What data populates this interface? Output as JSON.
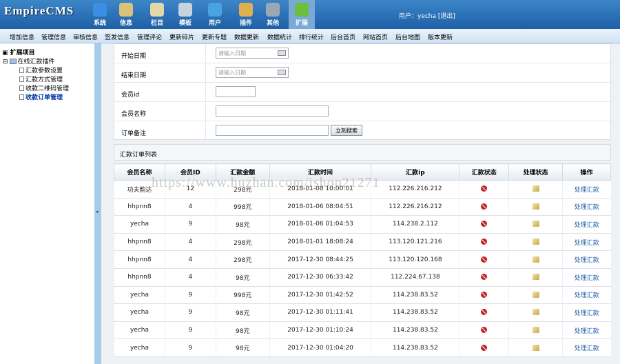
{
  "app": {
    "logo": "EmpireCMS"
  },
  "topnav": [
    {
      "label": "系统",
      "icon": "globe-icon",
      "color": "#3a8ee6"
    },
    {
      "label": "信息",
      "icon": "pencil-doc-icon",
      "color": "#d9c27a"
    },
    {
      "label": "栏目",
      "icon": "folder-icon",
      "color": "#e3d7a8"
    },
    {
      "label": "模板",
      "icon": "template-icon",
      "color": "#c9d3de"
    },
    {
      "label": "用户",
      "icon": "user-icon",
      "color": "#4aa3df"
    },
    {
      "label": "插件",
      "icon": "tools-icon",
      "color": "#e0b050"
    },
    {
      "label": "其他",
      "icon": "gear-icon",
      "color": "#9aa8b4"
    },
    {
      "label": "扩展",
      "icon": "plus-icon",
      "color": "#6cbf3a"
    }
  ],
  "user": {
    "text": "用户：yecha [退出]"
  },
  "menu": [
    "增加信息",
    "管理信息",
    "审核信息",
    "签发信息",
    "管理评论",
    "更新碎片",
    "更新专题",
    "数据更新",
    "数据统计",
    "排行统计",
    "后台首页",
    "网站首页",
    "后台地图",
    "版本更新"
  ],
  "sidebar": {
    "root": "扩展项目",
    "plugin": "在线汇款插件",
    "items": [
      "汇款参数设置",
      "汇款方式管理",
      "收款二维码管理",
      "收款订单管理"
    ],
    "collapse_arrow": "◂"
  },
  "form": {
    "start_label": "开始日期",
    "start_placeholder": "请输入日期",
    "end_label": "结束日期",
    "end_placeholder": "请输入日期",
    "member_id_label": "会员id",
    "member_name_label": "会员名称",
    "note_label": "订单备注",
    "search_button": "立刻搜索"
  },
  "list": {
    "title": "汇款订单列表",
    "columns": [
      "会员名称",
      "会员ID",
      "汇款金额",
      "汇款时间",
      "汇款ip",
      "汇款状态",
      "处理状态",
      "操作"
    ],
    "action_label": "处理汇款",
    "rows": [
      {
        "name": "功夫韵达",
        "id": "12",
        "amount": "298元",
        "time": "2018-01-08 10:00:01",
        "ip": "112.226.216.212"
      },
      {
        "name": "hhpnn8",
        "id": "4",
        "amount": "998元",
        "time": "2018-01-06 08:04:51",
        "ip": "112.226.216.212"
      },
      {
        "name": "yecha",
        "id": "9",
        "amount": "98元",
        "time": "2018-01-06 01:04:53",
        "ip": "114.238.2.112"
      },
      {
        "name": "hhpnn8",
        "id": "4",
        "amount": "298元",
        "time": "2018-01-01 18:08:24",
        "ip": "113.120.121.216"
      },
      {
        "name": "hhpnn8",
        "id": "4",
        "amount": "298元",
        "time": "2017-12-30 08:44:25",
        "ip": "113.120.120.168"
      },
      {
        "name": "hhpnn8",
        "id": "4",
        "amount": "98元",
        "time": "2017-12-30 06:33:42",
        "ip": "112.224.67.138"
      },
      {
        "name": "yecha",
        "id": "9",
        "amount": "998元",
        "time": "2017-12-30 01:42:52",
        "ip": "114.238.83.52"
      },
      {
        "name": "yecha",
        "id": "9",
        "amount": "98元",
        "time": "2017-12-30 01:11:41",
        "ip": "114.238.83.52"
      },
      {
        "name": "yecha",
        "id": "9",
        "amount": "98元",
        "time": "2017-12-30 01:10:24",
        "ip": "114.238.83.52"
      },
      {
        "name": "yecha",
        "id": "9",
        "amount": "98元",
        "time": "2017-12-30 01:04:20",
        "ip": "114.238.83.52"
      }
    ]
  },
  "watermark": "https://www.huzhan.com/ishop21271"
}
